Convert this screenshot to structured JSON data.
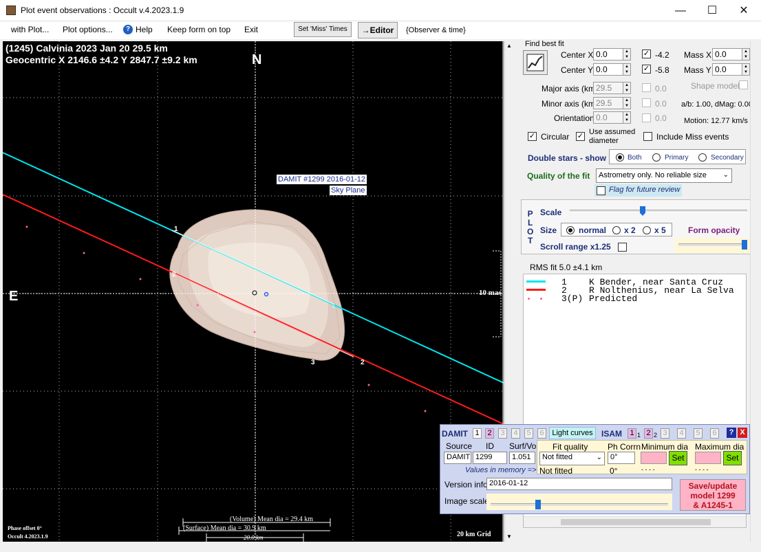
{
  "window": {
    "title": "Plot event observations : Occult v.4.2023.1.9",
    "minimize": "—",
    "maximize": "☐",
    "close": "✕"
  },
  "menu": {
    "with_plot": "with Plot...",
    "plot_options": "Plot options...",
    "help": "Help",
    "keep_form": "Keep form on top",
    "exit": "Exit",
    "set_miss": "Set 'Miss' Times",
    "editor": "→Editor",
    "observer_time": "{Observer & time}"
  },
  "plot": {
    "title1": "(1245) Calvinia  2023 Jan 20   29.5 km",
    "title2": "Geocentric  X  2146.6 ±4.2  Y 2847.7 ±9.2 km",
    "north": "N",
    "east": "E",
    "damit_label": "DAMIT #1299 2016-01-12",
    "sky_plane": "Sky Plane",
    "mas": "10 mas",
    "phase_offset": "Phase offset 0°",
    "version": "Occult 4.2023.1.9",
    "volume_dia": "(Volume) Mean dia = 29.4 km",
    "surface_dia": "(Surface) Mean dia = 30.9 km",
    "scale_km": "20.0 km",
    "grid": "20 km Grid",
    "chord1": "1",
    "chord2": "2",
    "chord3": "3"
  },
  "fit": {
    "find_best_fit": "Find best fit",
    "center_x": "Center X",
    "center_y": "Center Y",
    "cx_val": "0.0",
    "cy_val": "0.0",
    "cx_res": "-4.2",
    "cy_res": "-5.8",
    "mass_x": "Mass X",
    "mass_y": "Mass Y",
    "mx_val": "0.0",
    "my_val": "0.0",
    "major": "Major axis (km)",
    "minor": "Minor axis (km)",
    "orient": "Orientation",
    "major_val": "29.5",
    "minor_val": "29.5",
    "orient_val": "0.0",
    "major_res": "0.0",
    "minor_res": "0.0",
    "orient_res": "0.0",
    "shape_model": "Shape model",
    "ab": "a/b: 1.00, dMag: 0.00",
    "motion": "Motion: 12.77 km/s",
    "circular": "Circular",
    "use_assumed": "Use assumed",
    "diameter": "diameter",
    "include_miss": "Include Miss events"
  },
  "double": {
    "label": "Double stars - show",
    "both": "Both",
    "primary": "Primary",
    "secondary": "Secondary"
  },
  "quality": {
    "label": "Quality of the fit",
    "value": "Astrometry only. No reliable size",
    "flag": "Flag for future review"
  },
  "plotbox": {
    "p": "P",
    "l": "L",
    "o": "O",
    "t": "T",
    "scale": "Scale",
    "size": "Size",
    "normal": "normal",
    "x2": "x 2",
    "x5": "x 5",
    "form_opacity": "Form opacity",
    "scroll_range": "Scroll range x1.25"
  },
  "rms": "RMS fit 5.0 ±4.1 km",
  "legend": [
    {
      "num": "1",
      "name": "K Bender, near Santa Cruz",
      "color": "#00e5ee"
    },
    {
      "num": "2",
      "name": "R Nolthenius, near La Selva",
      "color": "#ff1a1a"
    },
    {
      "num": "3(P)",
      "name": "Predicted",
      "color": "#ff5ca8"
    }
  ],
  "damit": {
    "label": "DAMIT",
    "n1": "1",
    "n2": "2",
    "n3": "3",
    "n4": "4",
    "n5": "5",
    "n6": "6",
    "light_curves": "Light curves",
    "isam": "ISAM",
    "i1": "1",
    "i1s": "1",
    "i2": "2",
    "i2s": "2",
    "i3": "3",
    "i4": "4",
    "i5": "5",
    "i6": "6",
    "help": "?",
    "close": "X",
    "source": "Source",
    "id": "ID",
    "surfvol": "Surf/Vol",
    "source_val": "DAMIT",
    "id_val": "1299",
    "sv_val": "1.051",
    "fit_quality": "Fit quality",
    "ph_corrn": "Ph Corrn",
    "min_dia": "Minimum dia",
    "max_dia": "Maximum dia",
    "fq_val": "Not fitted",
    "ph_val": "0°",
    "set": "Set",
    "values_mem": "Values in memory =>",
    "mem_fq": "Not fitted",
    "mem_ph": "0°",
    "mem_min": "- - - -",
    "mem_max": "- - - -",
    "version_info": "Version info",
    "version_val": "2016-01-12",
    "image_scale": "Image scale",
    "save1": "Save/update",
    "save2": "model 1299",
    "save3": "& A1245-1"
  }
}
